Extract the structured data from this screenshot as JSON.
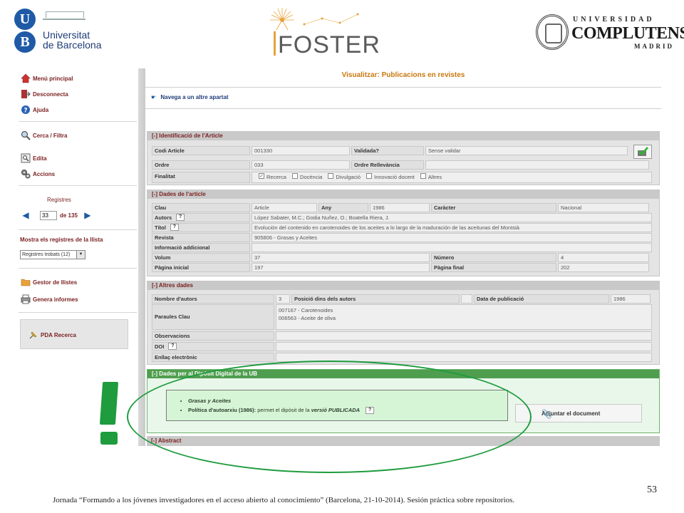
{
  "slide": {
    "logos": {
      "ub": {
        "letter_u": "U",
        "letter_b": "B",
        "line1": "Universitat",
        "line2": "de Barcelona"
      },
      "foster": {
        "name": "FOSTER"
      },
      "ucm": {
        "top": "UNIVERSIDAD",
        "main": "COMPLUTENSE",
        "bottom": "MADRID"
      }
    },
    "footer": "Jornada “Formando a los jóvenes investigadores en el acceso abierto al conocimiento” (Barcelona, 21-10-2014). Sesión práctica sobre repositorios.",
    "page_number": "53",
    "exclamation": "!",
    "accent_color": "#1e9c3e"
  },
  "sidebar": {
    "menu": [
      {
        "label": "Menú principal",
        "icon": "home-icon"
      },
      {
        "label": "Desconnecta",
        "icon": "logout-icon"
      },
      {
        "label": "Ajuda",
        "icon": "help-icon"
      },
      {
        "label": "Cerca / Filtra",
        "icon": "search-icon"
      },
      {
        "label": "Edita",
        "icon": "edit-icon"
      },
      {
        "label": "Accions",
        "icon": "gears-icon"
      }
    ],
    "registres_label": "Registres",
    "current_record": "33",
    "of_total": "de 135",
    "mostra_label": "Mostra els registres de la llista",
    "select_value": "Registres trobats (12)",
    "gestor_label": "Gestor de llistes",
    "informes_label": "Genera informes",
    "pda_label": "PDA Recerca"
  },
  "main": {
    "title": "Visualitzar: Publicacions en revistes",
    "navega": "Navega a un altre apartat",
    "ident": {
      "header": "[-] Identificació de l'Article",
      "codi_label": "Codi Article",
      "codi": "001330",
      "validada_label": "Validada?",
      "validada": "Sense validar",
      "ordre_label": "Ordre",
      "ordre": "033",
      "relev_label": "Ordre Rellevància",
      "finalitat_label": "Finalitat",
      "finalitats": [
        {
          "label": "Recerca",
          "checked": "✓"
        },
        {
          "label": "Docència",
          "checked": ""
        },
        {
          "label": "Divulgació",
          "checked": ""
        },
        {
          "label": "Innovació docent",
          "checked": ""
        },
        {
          "label": "Altres",
          "checked": ""
        }
      ]
    },
    "dades": {
      "header": "[-] Dades de l'article",
      "clau_label": "Clau",
      "clau": "Article",
      "any_label": "Any",
      "any": "1986",
      "caracter_label": "Caràcter",
      "caracter": "Nacional",
      "autors_label": "Autors",
      "autors": "López Sabater, M.C.; Godia Nuñez, O.; Boatella Riera, J.",
      "titol_label": "Títol",
      "titol": "Evolución del contenido en carotenoides de los aceites a lo largo de la maduración de las aceitunas del Montsià",
      "revista_label": "Revista",
      "revista": "905806 - Grasas y Aceites",
      "info_label": "Informació addicional",
      "volum_label": "Volum",
      "volum": "37",
      "numero_label": "Número",
      "numero": "4",
      "pinicial_label": "Pàgina inicial",
      "pinicial": "197",
      "pfinal_label": "Pàgina final",
      "pfinal": "202",
      "q": "?"
    },
    "altres": {
      "header": "[-] Altres dades",
      "nombre_label": "Nombre d'autors",
      "nombre": "3",
      "posicio_label": "Posició dins dels autors",
      "data_label": "Data de publicació",
      "data": "1986",
      "paraules_label": "Paraules Clau",
      "paraules": [
        "007167 - Carotenoides",
        "006563 - Aceite de oliva"
      ],
      "obs_label": "Observacions",
      "doi_label": "DOI",
      "enllac_label": "Enllaç electrònic"
    },
    "diposit": {
      "header": "[-] Dades per al Dipòsit Digital de la UB",
      "journal": "Grasas y Aceites",
      "policy_label": "Política d'autoarxiu (1986):",
      "policy_text": "permet el dipòsit de la",
      "policy_version": "versió PUBLICADA",
      "adjuntar": "Adjuntar el document"
    },
    "abstract_header": "[-] Abstract"
  }
}
